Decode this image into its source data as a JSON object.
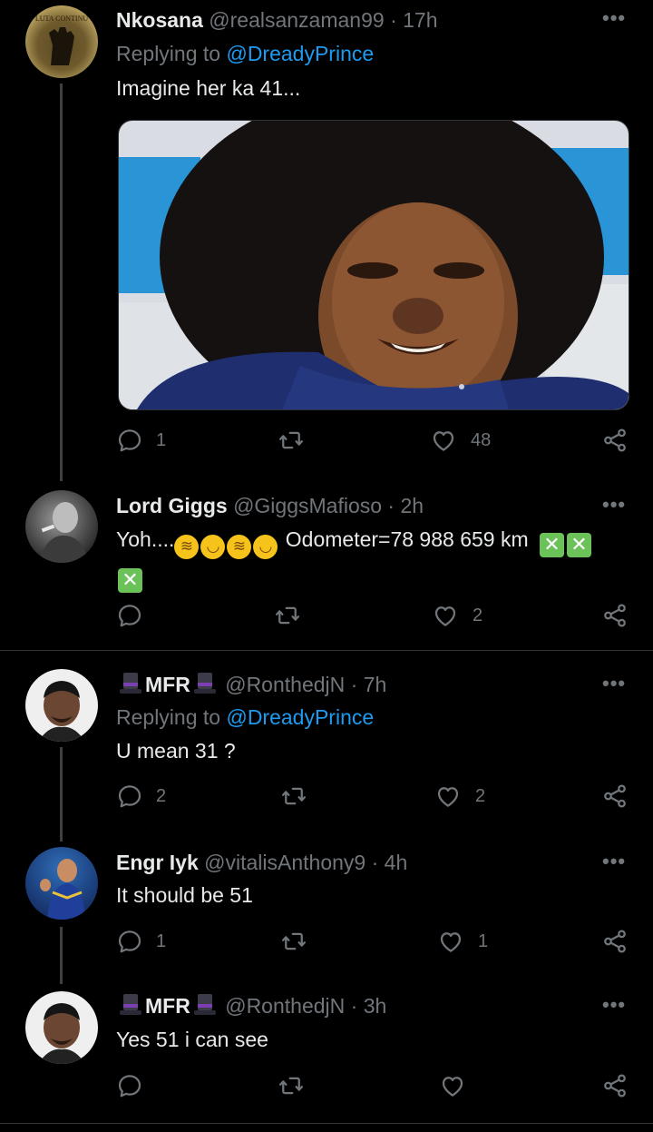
{
  "tweets": [
    {
      "name": "Nkosana",
      "handle": "@realsanzaman99",
      "time": "17h",
      "replying_prefix": "Replying to",
      "replying_to": "@DreadyPrince",
      "text": "Imagine her ka 41...",
      "avatar_label": "LUTA CONTINU",
      "replies": "1",
      "retweets": "",
      "likes": "48"
    },
    {
      "name": "Lord Giggs",
      "handle": "@GiggsMafioso",
      "time": "2h",
      "text_prefix": "Yoh....",
      "text_suffix": " Odometer=78 988 659 km",
      "emoji": [
        "rolling-on-floor-laughing",
        "tears-of-joy",
        "rolling-on-floor-laughing",
        "tears-of-joy"
      ],
      "replies": "",
      "retweets": "",
      "likes": "2"
    },
    {
      "name": "MFR",
      "handle": "@RonthedjN",
      "time": "7h",
      "replying_prefix": "Replying to",
      "replying_to": "@DreadyPrince",
      "text": "U mean 31 ?",
      "replies": "2",
      "retweets": "",
      "likes": "2"
    },
    {
      "name": "Engr Iyk",
      "handle": "@vitalisAnthony9",
      "time": "4h",
      "text": "It should be 51",
      "replies": "1",
      "retweets": "",
      "likes": "1"
    },
    {
      "name": "MFR",
      "handle": "@RonthedjN",
      "time": "3h",
      "text": "Yes 51 i can see",
      "replies": "",
      "retweets": "",
      "likes": ""
    }
  ],
  "separator": "·",
  "icons": {
    "reply": "reply-icon",
    "retweet": "retweet-icon",
    "like": "heart-icon",
    "share": "share-icon",
    "more": "more-icon"
  },
  "colors": {
    "background": "#000000",
    "text": "#e7e9ea",
    "muted": "#71767b",
    "link": "#1d9bf0",
    "divider": "#2f3336"
  }
}
